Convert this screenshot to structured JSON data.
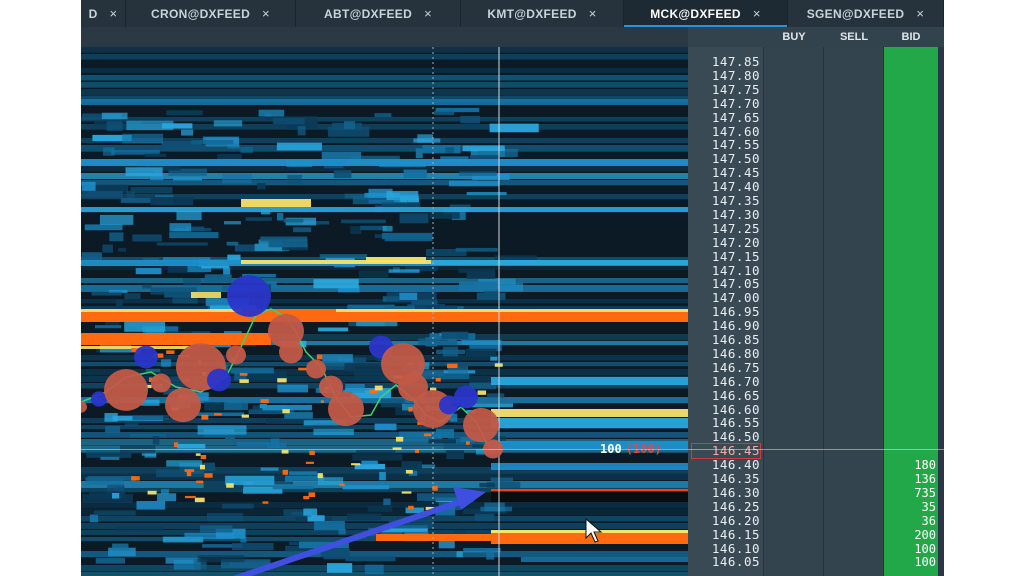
{
  "tabs": [
    {
      "label": "D",
      "close": "×"
    },
    {
      "label": "CRON@DXFEED",
      "close": "×"
    },
    {
      "label": "ABT@DXFEED",
      "close": "×"
    },
    {
      "label": "KMT@DXFEED",
      "close": "×"
    },
    {
      "label": "MCK@DXFEED",
      "close": "×",
      "active": true
    },
    {
      "label": "SGEN@DXFEED",
      "close": "×"
    }
  ],
  "ladder": {
    "headers": {
      "buy": "BUY",
      "sell": "SELL",
      "bid": "BID"
    },
    "prices": [
      "147.85",
      "147.80",
      "147.75",
      "147.70",
      "147.65",
      "147.60",
      "147.55",
      "147.50",
      "147.45",
      "147.40",
      "147.35",
      "147.30",
      "147.25",
      "147.20",
      "147.15",
      "147.10",
      "147.05",
      "147.00",
      "146.95",
      "146.90",
      "146.85",
      "146.80",
      "146.75",
      "146.70",
      "146.65",
      "146.60",
      "146.55",
      "146.50",
      "146.45",
      "146.40",
      "146.35",
      "146.30",
      "146.25",
      "146.20",
      "146.15",
      "146.10",
      "146.05"
    ],
    "highlight_price": "146.45",
    "bids": [
      {
        "price": "146.40",
        "size": "180"
      },
      {
        "price": "146.35",
        "size": "136"
      },
      {
        "price": "146.30",
        "size": "735"
      },
      {
        "price": "146.25",
        "size": "35"
      },
      {
        "price": "146.20",
        "size": "36"
      },
      {
        "price": "146.15",
        "size": "200"
      },
      {
        "price": "146.10",
        "size": "100"
      },
      {
        "price": "146.05",
        "size": "100"
      }
    ]
  },
  "last_trade": {
    "size": "100",
    "size_paren": "(100)"
  },
  "colors": {
    "accent": "#2f8fd8",
    "bid_column": "#22a849",
    "highlight": "#d03a3a",
    "heat_orange": "#ff6a10",
    "heat_yellow": "#f7e26a",
    "heat_blue": "#1e8fc9",
    "bubble_sell": "#c25a48",
    "bubble_buy": "#2a35c9",
    "arrow": "#3f4fe0"
  }
}
